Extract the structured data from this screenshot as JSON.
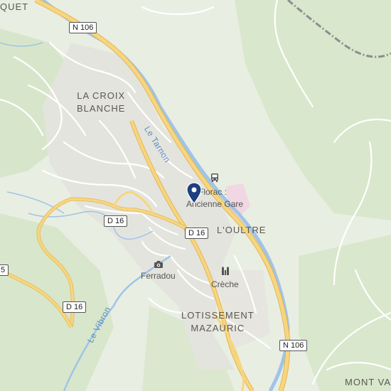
{
  "map": {
    "areas": {
      "la_croix_blanche": [
        "LA CROIX",
        "BLANCHE"
      ],
      "loultre": "L'OULTRE",
      "lotissement_mazauric": [
        "LOTISSEMENT",
        "MAZAURIC"
      ],
      "mont_va": "MONT VA",
      "quet": "QUET"
    },
    "rivers": {
      "tarnon": "Le Tarnon",
      "vibron": "Le Vibron"
    },
    "roads": {
      "n106_top": "N 106",
      "n106_bottom": "N 106",
      "d16_a": "D 16",
      "d16_b": "D 16",
      "d16_c": "D 16",
      "d16_edge": "5"
    },
    "pois": {
      "station": [
        "Florac :",
        "Ancienne Gare"
      ],
      "ferradou": "Ferradou",
      "creche": "Crèche"
    },
    "icons": {
      "marker": "map-pin-icon",
      "bus": "bus-icon",
      "camera": "camera-icon",
      "school": "school-icon"
    },
    "colors": {
      "land": "#e9eee2",
      "forest": "#d6e5c9",
      "urban": "#e3e2dc",
      "water": "#9fc4e8",
      "highway": "#f4d27c",
      "marker": "#1e3f7f"
    }
  }
}
